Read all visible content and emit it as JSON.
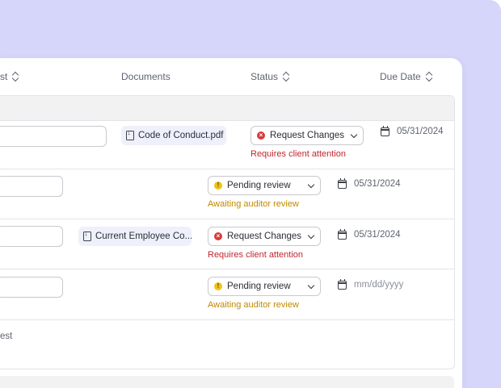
{
  "columns": {
    "first_partial": "st",
    "documents": "Documents",
    "status": "Status",
    "due_date": "Due Date"
  },
  "rows": [
    {
      "document": "Code of Conduct.pdf",
      "status": "Request Changes",
      "status_type": "error",
      "note": "Requires client attention",
      "due_date": "05/31/2024"
    },
    {
      "document": "",
      "status": "Pending review",
      "status_type": "pending",
      "note": "Awaiting auditor review",
      "due_date": "05/31/2024"
    },
    {
      "document": "Current Employee Co...",
      "status": "Request Changes",
      "status_type": "error",
      "note": "Requires client attention",
      "due_date": "05/31/2024"
    },
    {
      "document": "",
      "status": "Pending review",
      "status_type": "pending",
      "note": "Awaiting auditor review",
      "due_date": "mm/dd/yyyy"
    }
  ],
  "trailing_text": "est",
  "icons": {
    "sort": "sort-icon",
    "file": "file-download-icon",
    "calendar": "calendar-icon",
    "error": "x-circle-icon",
    "pending": "exclamation-circle-icon",
    "chevron": "chevron-down-icon"
  },
  "colors": {
    "background": "#d6d6fb",
    "error": "#c0262d",
    "pending": "#c08a00"
  }
}
